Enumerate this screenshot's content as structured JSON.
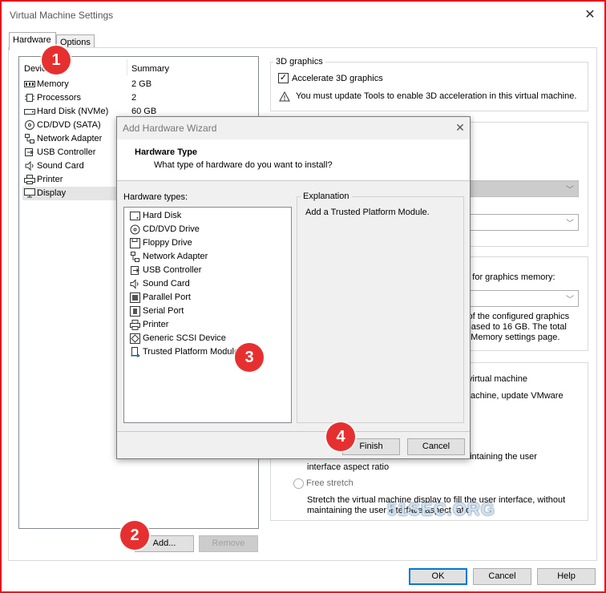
{
  "window": {
    "title": "Virtual Machine Settings"
  },
  "tabs": [
    {
      "label": "Hardware"
    },
    {
      "label": "Options"
    }
  ],
  "device_list": {
    "headers": [
      "Device",
      "Summary"
    ],
    "rows": [
      {
        "name": "Memory",
        "summary": "2 GB",
        "icon": "memory-icon"
      },
      {
        "name": "Processors",
        "summary": "2",
        "icon": "processor-icon"
      },
      {
        "name": "Hard Disk (NVMe)",
        "summary": "60 GB",
        "icon": "hard-disk-icon"
      },
      {
        "name": "CD/DVD (SATA)",
        "summary": "",
        "icon": "cd-dvd-icon"
      },
      {
        "name": "Network Adapter",
        "summary": "",
        "icon": "network-adapter-icon"
      },
      {
        "name": "USB Controller",
        "summary": "",
        "icon": "usb-icon"
      },
      {
        "name": "Sound Card",
        "summary": "",
        "icon": "sound-card-icon"
      },
      {
        "name": "Printer",
        "summary": "",
        "icon": "printer-icon"
      },
      {
        "name": "Display",
        "summary": "",
        "icon": "display-icon"
      }
    ],
    "add_label": "Add...",
    "remove_label": "Remove"
  },
  "display_panel": {
    "group_3d_label": "3D graphics",
    "accelerate_label": "Accelerate 3D graphics",
    "warning": "You must update Tools to enable 3D acceleration in this virtual machine.",
    "memory_text": "ed for graphics memory:",
    "memory_note_1": "l of the configured graphics",
    "memory_note_2": "reased to 16 GB. The total",
    "memory_note_3": "e Memory settings page.",
    "vm_text_1": "virtual machine",
    "vm_text_2": "achine, update VMware",
    "stretch_keep_1": "interface aspect ratio",
    "free_stretch_label": "Free stretch",
    "free_stretch_desc_1": "Stretch the virtual machine display to fill the user interface, without",
    "free_stretch_desc_2": "maintaining the user interface aspect ratio",
    "keep_aspect_text": "aintaining the user"
  },
  "footer": {
    "ok_label": "OK",
    "cancel_label": "Cancel",
    "help_label": "Help"
  },
  "wizard": {
    "title": "Add Hardware Wizard",
    "header_title": "Hardware Type",
    "header_subtitle": "What type of hardware do you want to install?",
    "types_label": "Hardware types:",
    "types": [
      {
        "name": "Hard Disk",
        "icon": "hard-disk-icon"
      },
      {
        "name": "CD/DVD Drive",
        "icon": "cd-dvd-icon"
      },
      {
        "name": "Floppy Drive",
        "icon": "floppy-icon"
      },
      {
        "name": "Network Adapter",
        "icon": "network-adapter-icon"
      },
      {
        "name": "USB Controller",
        "icon": "usb-icon"
      },
      {
        "name": "Sound Card",
        "icon": "sound-card-icon"
      },
      {
        "name": "Parallel Port",
        "icon": "parallel-port-icon"
      },
      {
        "name": "Serial Port",
        "icon": "serial-port-icon"
      },
      {
        "name": "Printer",
        "icon": "printer-icon"
      },
      {
        "name": "Generic SCSI Device",
        "icon": "scsi-icon"
      },
      {
        "name": "Trusted Platform Module",
        "icon": "tpm-icon"
      }
    ],
    "explanation_label": "Explanation",
    "explanation_text": "Add a Trusted Platform Module.",
    "finish_label": "Finish",
    "cancel_label": "Cancel"
  },
  "badges": [
    "1",
    "2",
    "3",
    "4"
  ],
  "watermark": "51SEC.ORG",
  "colors": {
    "badge": "#e63030",
    "border": "#e8141b",
    "focus": "#0078d7"
  }
}
